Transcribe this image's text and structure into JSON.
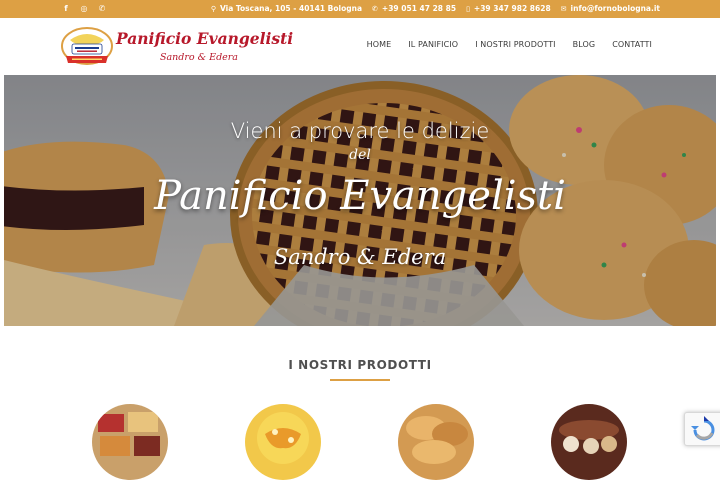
{
  "topbar": {
    "social": [
      {
        "name": "facebook",
        "glyph": "f"
      },
      {
        "name": "instagram",
        "glyph": "◎"
      },
      {
        "name": "whatsapp",
        "glyph": "✆"
      }
    ],
    "address": "Via Toscana, 105 - 40141 Bologna",
    "phone1": "+39 051 47 28 85",
    "phone2": "+39 347 982 8628",
    "email": "info@fornobologna.it",
    "icons": {
      "address": "map-marker-icon",
      "phone": "phone-icon",
      "mobile": "mobile-icon",
      "email": "envelope-icon"
    }
  },
  "logo": {
    "title": "Panificio Evangelisti",
    "subtitle": "Sandro & Edera"
  },
  "nav": {
    "items": [
      "HOME",
      "IL PANIFICIO",
      "I NOSTRI PRODOTTI",
      "BLOG",
      "CONTATTI"
    ]
  },
  "hero": {
    "line1": "Vieni a provare le delizie",
    "line2": "del",
    "line3": "Panificio Evangelisti",
    "line4": "Sandro & Edera"
  },
  "products_section": {
    "title": "I NOSTRI PRODOTTI"
  },
  "colors": {
    "topbar": "#dda044",
    "brand_red": "#b7182a",
    "nav_text": "#3a3a3a",
    "accent": "#dda044"
  }
}
